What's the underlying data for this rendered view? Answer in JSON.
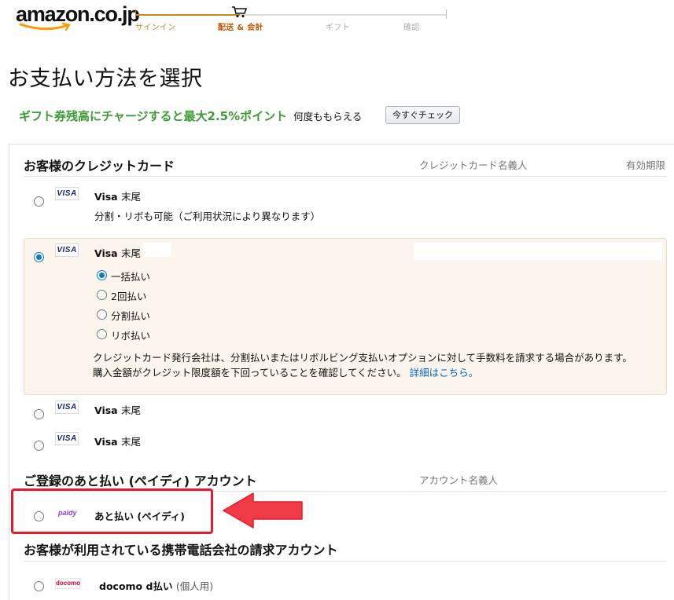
{
  "header": {
    "logo_text": "amazon.co.jp",
    "steps": [
      "サインイン",
      "配送 & 会計",
      "ギフト",
      "確認"
    ]
  },
  "page_title": "お支払い方法を選択",
  "promo": {
    "main": "ギフト券残高にチャージすると最大2.5%ポイント",
    "sub": "何度ももらえる",
    "button": "今すぐチェック"
  },
  "credit_cards": {
    "title": "お客様のクレジットカード",
    "col_name": "クレジットカード名義人",
    "col_expiry": "有効期限",
    "cards": [
      {
        "brand": "VISA",
        "label": "Visa",
        "suffix": "末尾",
        "note": "分割・リボも可能（ご利用状況により異なります）",
        "selected": false
      },
      {
        "brand": "VISA",
        "label": "Visa",
        "suffix": "末尾",
        "selected": true
      },
      {
        "brand": "VISA",
        "label": "Visa",
        "suffix": "末尾",
        "selected": false
      },
      {
        "brand": "VISA",
        "label": "Visa",
        "suffix": "末尾",
        "selected": false
      }
    ],
    "installments": [
      {
        "label": "一括払い",
        "selected": true
      },
      {
        "label": "2回払い",
        "selected": false
      },
      {
        "label": "分割払い",
        "selected": false
      },
      {
        "label": "リボ払い",
        "selected": false
      }
    ],
    "disclaimer_line1": "クレジットカード発行会社は、分割払いまたはリボルビング支払いオプションに対して手数料を請求する場合があります。",
    "disclaimer_line2": "購入金額がクレジット限度額を下回っていることを確認してください。",
    "details_link": "詳細はこちら",
    "details_period": "。"
  },
  "paidy": {
    "title": "ご登録のあと払い (ペイディ) アカウント",
    "col_name": "アカウント名義人",
    "logo": "paidy",
    "label": "あと払い (ペイディ)"
  },
  "carrier": {
    "title": "お客様が利用されている携帯電話会社の請求アカウント",
    "logo": "docomo",
    "label": "docomo d払い",
    "sub": "(個人用)"
  },
  "colors": {
    "accent_orange": "#c45500",
    "promo_green": "#3c9b35",
    "radio_blue": "#0a7ac4",
    "link_blue": "#0066c0",
    "highlight_red": "#e41b2c"
  }
}
